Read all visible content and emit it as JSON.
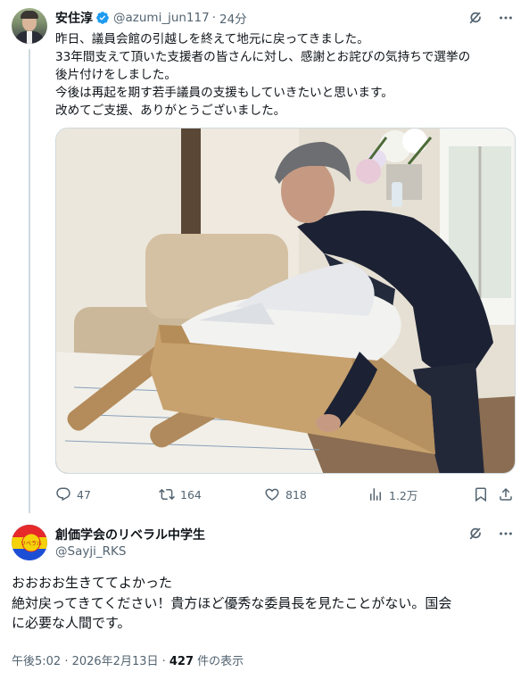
{
  "tweet1": {
    "author_name": "安住淳",
    "handle": "@azumi_jun117",
    "separator": "·",
    "time": "24分",
    "text_lines": [
      "昨日、議員会館の引越しを終えて地元に戻ってきました。",
      "33年間支えて頂いた支援者の皆さんに対し、感謝とお詫びの気持ちで選挙の",
      "後片付けをしました。",
      "今後は再起を期す若手議員の支援もしていきたいと思います。",
      "改めてご支援、ありがとうございました。"
    ],
    "photo_desc_icon": "photo",
    "actions": {
      "replies": "47",
      "retweets": "164",
      "likes": "818",
      "views": "1.2万"
    },
    "verified_color": "#1d9bf0"
  },
  "tweet2": {
    "author_name": "創価学会のリベラル中学生",
    "handle": "@Sayji_RKS",
    "text_lines": [
      "おおおお生きててよかった",
      "絶対戻ってきてください！貴方ほど優秀な委員長を見たことがない。国会",
      "に必要な人間です。"
    ],
    "timestamp": "午後5:02 · 2026年2月13日 · ",
    "views_count": "427",
    "views_label": " 件の表示"
  },
  "colors": {
    "text": "#0f1419",
    "secondary": "#536471",
    "border": "#cfd9de",
    "accent": "#1d9bf0"
  }
}
